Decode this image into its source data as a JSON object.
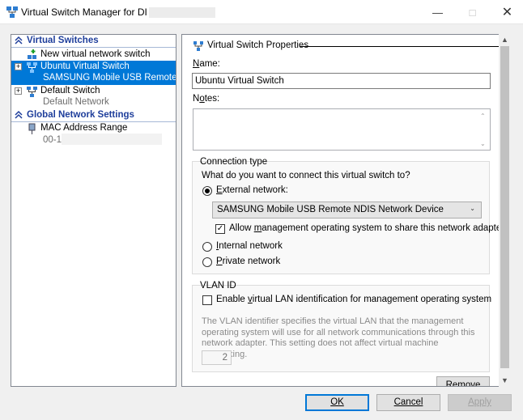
{
  "window": {
    "title": "Virtual Switch Manager for DI",
    "icon": "virtual-switch-icon"
  },
  "sidebar": {
    "virtual_switches_header": "Virtual Switches",
    "global_settings_header": "Global Network Settings",
    "new_switch_label": "New virtual network switch",
    "items": [
      {
        "label": "Ubuntu Virtual Switch",
        "sublabel": "SAMSUNG Mobile USB Remote NDI...",
        "selected": true
      },
      {
        "label": "Default Switch",
        "sublabel": "Default Network",
        "selected": false
      }
    ],
    "mac_range": {
      "label": "MAC Address Range",
      "value": "00-15"
    }
  },
  "properties": {
    "header": "Virtual Switch Properties",
    "name_label": "Name:",
    "name_value": "Ubuntu Virtual Switch",
    "notes_label": "Notes:",
    "notes_value": "",
    "connection_type": {
      "title": "Connection type",
      "question": "What do you want to connect this virtual switch to?",
      "external_label": "External network:",
      "external_adapter": "SAMSUNG Mobile USB Remote NDIS Network Device",
      "allow_mgmt_label": "Allow management operating system to share this network adapter",
      "allow_mgmt_checked": true,
      "internal_label": "Internal network",
      "private_label": "Private network",
      "selected": "external"
    },
    "vlan": {
      "title": "VLAN ID",
      "enable_label": "Enable virtual LAN identification for management operating system",
      "enable_checked": false,
      "description": "The VLAN identifier specifies the virtual LAN that the management operating system will use for all network communications through this network adapter. This setting does not affect virtual machine networking.",
      "vlan_value": "2"
    },
    "remove_label": "Remove"
  },
  "buttons": {
    "ok": "OK",
    "cancel": "Cancel",
    "apply": "Apply"
  },
  "colors": {
    "selection": "#0078d7",
    "section_header": "#1e3e9b"
  }
}
